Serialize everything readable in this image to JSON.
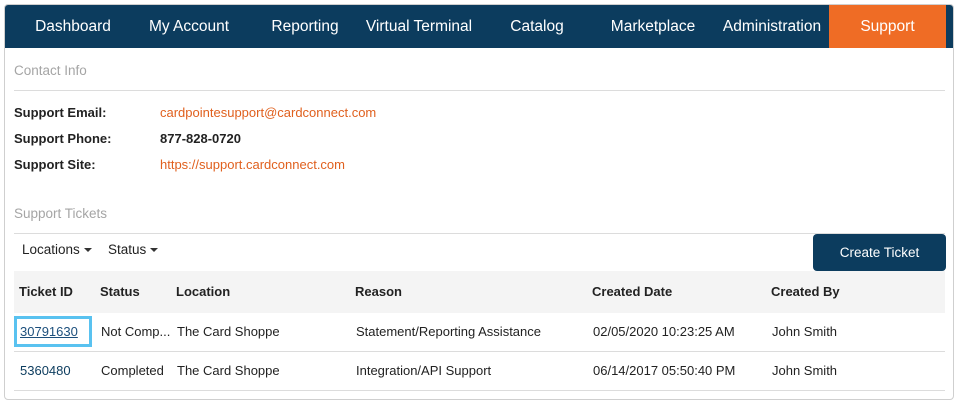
{
  "nav": {
    "items": [
      {
        "label": "Dashboard"
      },
      {
        "label": "My Account"
      },
      {
        "label": "Reporting"
      },
      {
        "label": "Virtual Terminal"
      },
      {
        "label": "Catalog"
      },
      {
        "label": "Marketplace"
      },
      {
        "label": "Administration"
      },
      {
        "label": "Support"
      }
    ],
    "active": "Support",
    "active_color": "#ef6c25",
    "bar_color": "#0c3c5e"
  },
  "contact": {
    "title": "Contact Info",
    "email_label": "Support Email:",
    "email_value": "cardpointesupport@cardconnect.com",
    "phone_label": "Support Phone:",
    "phone_value": "877-828-0720",
    "site_label": "Support Site:",
    "site_value": "https://support.cardconnect.com"
  },
  "tickets": {
    "title": "Support Tickets",
    "filters": {
      "locations": "Locations",
      "status": "Status"
    },
    "create_label": "Create Ticket",
    "columns": [
      "Ticket ID",
      "Status",
      "Location",
      "Reason",
      "Created Date",
      "Created By"
    ],
    "rows": [
      {
        "id": "30791630",
        "status": "Not Comp...",
        "location": "The Card Shoppe",
        "reason": "Statement/Reporting Assistance",
        "created": "02/05/2020 10:23:25 AM",
        "by": "John Smith"
      },
      {
        "id": "5360480",
        "status": "Completed",
        "location": "The Card Shoppe",
        "reason": "Integration/API Support",
        "created": "06/14/2017 05:50:40 PM",
        "by": "John Smith"
      }
    ]
  }
}
